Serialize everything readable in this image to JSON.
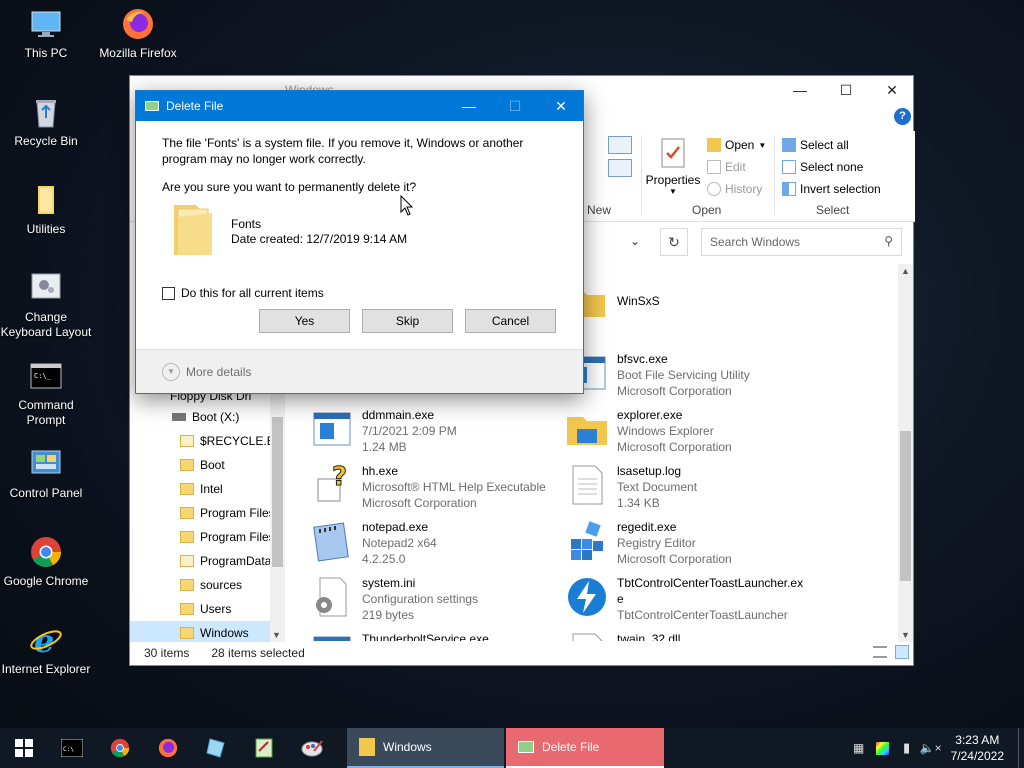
{
  "desktop": {
    "icons": [
      {
        "label": "This PC"
      },
      {
        "label": "Mozilla Firefox"
      },
      {
        "label": "Recycle Bin"
      },
      {
        "label": "Utilities"
      },
      {
        "label": "Change Keyboard Layout"
      },
      {
        "label": "Command Prompt"
      },
      {
        "label": "Control Panel"
      },
      {
        "label": "Google Chrome"
      },
      {
        "label": "Internet Explorer"
      }
    ]
  },
  "explorer": {
    "title": "Windows",
    "ribbon": {
      "new_group": "New",
      "new_partial": "w\nlder",
      "properties": "Properties",
      "open": "Open",
      "edit": "Edit",
      "history": "History",
      "open_group": "Open",
      "select_all": "Select all",
      "select_none": "Select none",
      "invert_selection": "Invert selection",
      "select_group": "Select"
    },
    "search_placeholder": "Search Windows",
    "nav": [
      {
        "label": "Floppy Disk Dri"
      },
      {
        "label": "Boot (X:)"
      },
      {
        "label": "$RECYCLE.BIN"
      },
      {
        "label": "Boot"
      },
      {
        "label": "Intel"
      },
      {
        "label": "Program Files"
      },
      {
        "label": "Program Files"
      },
      {
        "label": "ProgramData"
      },
      {
        "label": "sources"
      },
      {
        "label": "Users"
      },
      {
        "label": "Windows"
      }
    ],
    "files": [
      {
        "name": "WinSxS",
        "l1": "",
        "l2": ""
      },
      {
        "name": "bfsvc.exe",
        "l1": "Boot File Servicing Utility",
        "l2": "Microsoft Corporation"
      },
      {
        "name": "ddmmain.exe",
        "l1": "7/1/2021 2:09 PM",
        "l2": "1.24 MB"
      },
      {
        "name": "explorer.exe",
        "l1": "Windows Explorer",
        "l2": "Microsoft Corporation"
      },
      {
        "name": "hh.exe",
        "l1": "Microsoft® HTML Help Executable",
        "l2": "Microsoft Corporation"
      },
      {
        "name": "lsasetup.log",
        "l1": "Text Document",
        "l2": "1.34 KB"
      },
      {
        "name": "notepad.exe",
        "l1": "Notepad2 x64",
        "l2": "4.2.25.0"
      },
      {
        "name": "regedit.exe",
        "l1": "Registry Editor",
        "l2": "Microsoft Corporation"
      },
      {
        "name": "system.ini",
        "l1": "Configuration settings",
        "l2": "219 bytes"
      },
      {
        "name": "TbtControlCenterToastLauncher.exe",
        "l1": "TbtControlCenterToastLauncher",
        "l2": ""
      },
      {
        "name": "ThunderboltService.exe",
        "l1": "",
        "l2": ""
      },
      {
        "name": "twain_32.dll",
        "l1": "",
        "l2": ""
      }
    ],
    "status_items": "30 items",
    "status_selected": "28 items selected"
  },
  "dialog": {
    "title": "Delete File",
    "message": "The file 'Fonts' is a system file. If you remove it, Windows or another program may no longer work correctly.",
    "question": "Are you sure you want to permanently delete it?",
    "item_name": "Fonts",
    "item_date": "Date created: 12/7/2019 9:14 AM",
    "checkbox_label": "Do this for all current items",
    "yes": "Yes",
    "skip": "Skip",
    "cancel": "Cancel",
    "more_details": "More details"
  },
  "taskbar": {
    "task_windows": "Windows",
    "task_delete": "Delete File",
    "time": "3:23 AM",
    "date": "7/24/2022"
  },
  "colors": {
    "accent": "#0078d7",
    "taskbar": "#101823",
    "active_task": "#e8696f"
  }
}
